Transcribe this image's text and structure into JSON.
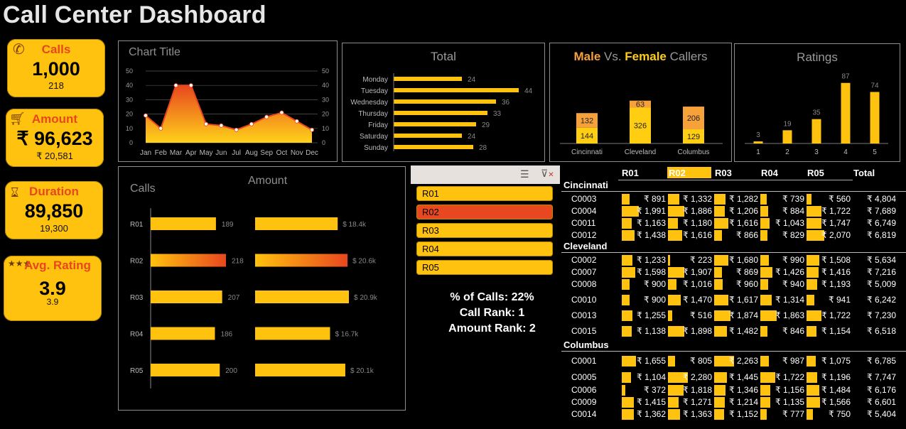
{
  "title": "Call Center Dashboard",
  "colors": {
    "accent": "#ffc20e",
    "highlight": "#e8471f",
    "male": "#f7a13a",
    "female": "#ffcd12"
  },
  "kpis": {
    "calls": {
      "label": "Calls",
      "value": "1,000",
      "sub": "218",
      "icon": "phone-icon"
    },
    "amount": {
      "label": "Amount",
      "value": "₹ 96,623",
      "sub": "₹ 20,581",
      "icon": "cart-icon"
    },
    "duration": {
      "label": "Duration",
      "value": "89,850",
      "sub": "19,300",
      "icon": "hourglass-icon"
    },
    "rating": {
      "label": "Avg. Rating",
      "value": "3.9",
      "sub": "3.9",
      "icon": "stars-icon"
    }
  },
  "chart_data": [
    {
      "type": "area",
      "title": "Chart Title",
      "categories": [
        "Jan",
        "Feb",
        "Mar",
        "Apr",
        "May",
        "Jun",
        "Jul",
        "Aug",
        "Sep",
        "Oct",
        "Nov",
        "Dec"
      ],
      "values": [
        19,
        10,
        40,
        40,
        13,
        12,
        9,
        13,
        18,
        21,
        15,
        9
      ],
      "ylim": [
        0,
        50
      ],
      "yticks": [
        0,
        10,
        20,
        30,
        40,
        50
      ]
    },
    {
      "type": "bar",
      "title": "Total",
      "categories": [
        "Monday",
        "Tuesday",
        "Wednesday",
        "Thursday",
        "Friday",
        "Saturday",
        "Sunday"
      ],
      "values": [
        24,
        44,
        36,
        33,
        29,
        24,
        28
      ]
    },
    {
      "type": "bar",
      "title_parts": [
        "Male",
        " Vs. ",
        "Female",
        " Callers"
      ],
      "categories": [
        "Cincinnati",
        "Cleveland",
        "Columbus"
      ],
      "series": [
        {
          "name": "Female",
          "values": [
            144,
            326,
            129
          ]
        },
        {
          "name": "Male",
          "values": [
            132,
            63,
            206
          ]
        }
      ]
    },
    {
      "type": "bar",
      "title": "Ratings",
      "categories": [
        "1",
        "2",
        "3",
        "4",
        "5"
      ],
      "values": [
        3,
        19,
        35,
        87,
        74
      ]
    },
    {
      "type": "bar",
      "title_calls": "Calls",
      "title_amount": "Amount",
      "categories": [
        "R01",
        "R02",
        "R03",
        "R04",
        "R05"
      ],
      "calls": [
        189,
        218,
        207,
        186,
        200
      ],
      "amount_labels": [
        "$ 18.4k",
        "$ 20.6k",
        "$ 20.9k",
        "$ 16.7k",
        "$ 20.1k"
      ],
      "amount": [
        18.4,
        20.6,
        20.9,
        16.7,
        20.1
      ],
      "highlight": "R02"
    }
  ],
  "slicer": {
    "items": [
      "R01",
      "R02",
      "R03",
      "R04",
      "R05"
    ],
    "selected": "R02"
  },
  "stats": {
    "pct": "% of Calls: 22%",
    "call_rank": "Call Rank: 1",
    "amount_rank": "Amount Rank: 2"
  },
  "table": {
    "headers": [
      "R01",
      "R02",
      "R03",
      "R04",
      "R05",
      "Total"
    ],
    "groups": [
      {
        "name": "Cincinnati",
        "rows": [
          {
            "id": "C0003",
            "v": [
              891,
              1332,
              1282,
              739,
              560
            ],
            "labels": [
              "₹ 891",
              "₹ 1,332",
              "₹ 1,282",
              "₹ 739",
              "₹ 560"
            ],
            "total": "₹ 4,804"
          },
          {
            "id": "C0004",
            "v": [
              1991,
              1886,
              1206,
              884,
              1722
            ],
            "labels": [
              "₹ 1,991",
              "₹ 1,886",
              "₹ 1,206",
              "₹ 884",
              "₹ 1,722"
            ],
            "total": "₹ 7,689"
          },
          {
            "id": "C0011",
            "v": [
              1163,
              1180,
              1616,
              1043,
              1747
            ],
            "labels": [
              "₹ 1,163",
              "₹ 1,180",
              "₹ 1,616",
              "₹ 1,043",
              "₹ 1,747"
            ],
            "total": "₹ 6,749"
          },
          {
            "id": "C0012",
            "v": [
              1438,
              1616,
              866,
              829,
              2070
            ],
            "labels": [
              "₹ 1,438",
              "₹ 1,616",
              "₹ 866",
              "₹ 829",
              "₹ 2,070"
            ],
            "total": "₹ 6,819"
          }
        ]
      },
      {
        "name": "Cleveland",
        "rows": [
          {
            "id": "C0002",
            "v": [
              1233,
              223,
              1680,
              990,
              1508
            ],
            "labels": [
              "₹ 1,233",
              "₹ 223",
              "₹ 1,680",
              "₹ 990",
              "₹ 1,508"
            ],
            "total": "₹ 5,634"
          },
          {
            "id": "C0007",
            "v": [
              1598,
              1907,
              869,
              1426,
              1416
            ],
            "labels": [
              "₹ 1,598",
              "₹ 1,907",
              "₹ 869",
              "₹ 1,426",
              "₹ 1,416"
            ],
            "total": "₹ 7,216"
          },
          {
            "id": "C0008",
            "v": [
              900,
              1016,
              960,
              940,
              1193
            ],
            "labels": [
              "₹ 900",
              "₹ 1,016",
              "₹ 960",
              "₹ 940",
              "₹ 1,193"
            ],
            "total": "₹ 5,009"
          },
          {
            "id": "C0010",
            "v": [
              900,
              1470,
              1617,
              1314,
              941
            ],
            "labels": [
              "₹ 900",
              "₹ 1,470",
              "₹ 1,617",
              "₹ 1,314",
              "₹ 941"
            ],
            "total": "₹ 6,242"
          },
          {
            "id": "C0013",
            "v": [
              1255,
              516,
              1874,
              1863,
              1722
            ],
            "labels": [
              "₹ 1,255",
              "₹ 516",
              "₹ 1,874",
              "₹ 1,863",
              "₹ 1,722"
            ],
            "total": "₹ 7,230"
          },
          {
            "id": "C0015",
            "v": [
              1138,
              1898,
              1482,
              846,
              1154
            ],
            "labels": [
              "₹ 1,138",
              "₹ 1,898",
              "₹ 1,482",
              "₹ 846",
              "₹ 1,154"
            ],
            "total": "₹ 6,518"
          }
        ]
      },
      {
        "name": "Columbus",
        "rows": [
          {
            "id": "C0001",
            "v": [
              1655,
              805,
              2263,
              987,
              1075
            ],
            "labels": [
              "₹ 1,655",
              "₹ 805",
              "₹ 2,263",
              "₹ 987",
              "₹ 1,075"
            ],
            "total": "₹ 6,785"
          },
          {
            "id": "C0005",
            "v": [
              1104,
              2280,
              1445,
              1722,
              1196
            ],
            "labels": [
              "₹ 1,104",
              "₹ 2,280",
              "₹ 1,445",
              "₹ 1,722",
              "₹ 1,196"
            ],
            "total": "₹ 7,747"
          },
          {
            "id": "C0006",
            "v": [
              372,
              1818,
              1346,
              1156,
              1484
            ],
            "labels": [
              "₹ 372",
              "₹ 1,818",
              "₹ 1,346",
              "₹ 1,156",
              "₹ 1,484"
            ],
            "total": "₹ 6,176"
          },
          {
            "id": "C0009",
            "v": [
              1415,
              1271,
              1214,
              1135,
              1566
            ],
            "labels": [
              "₹ 1,415",
              "₹ 1,271",
              "₹ 1,214",
              "₹ 1,135",
              "₹ 1,566"
            ],
            "total": "₹ 6,601"
          },
          {
            "id": "C0014",
            "v": [
              1362,
              1363,
              1152,
              777,
              750
            ],
            "labels": [
              "₹ 1,362",
              "₹ 1,363",
              "₹ 1,152",
              "₹ 777",
              "₹ 750"
            ],
            "total": "₹ 5,404"
          }
        ]
      }
    ]
  }
}
